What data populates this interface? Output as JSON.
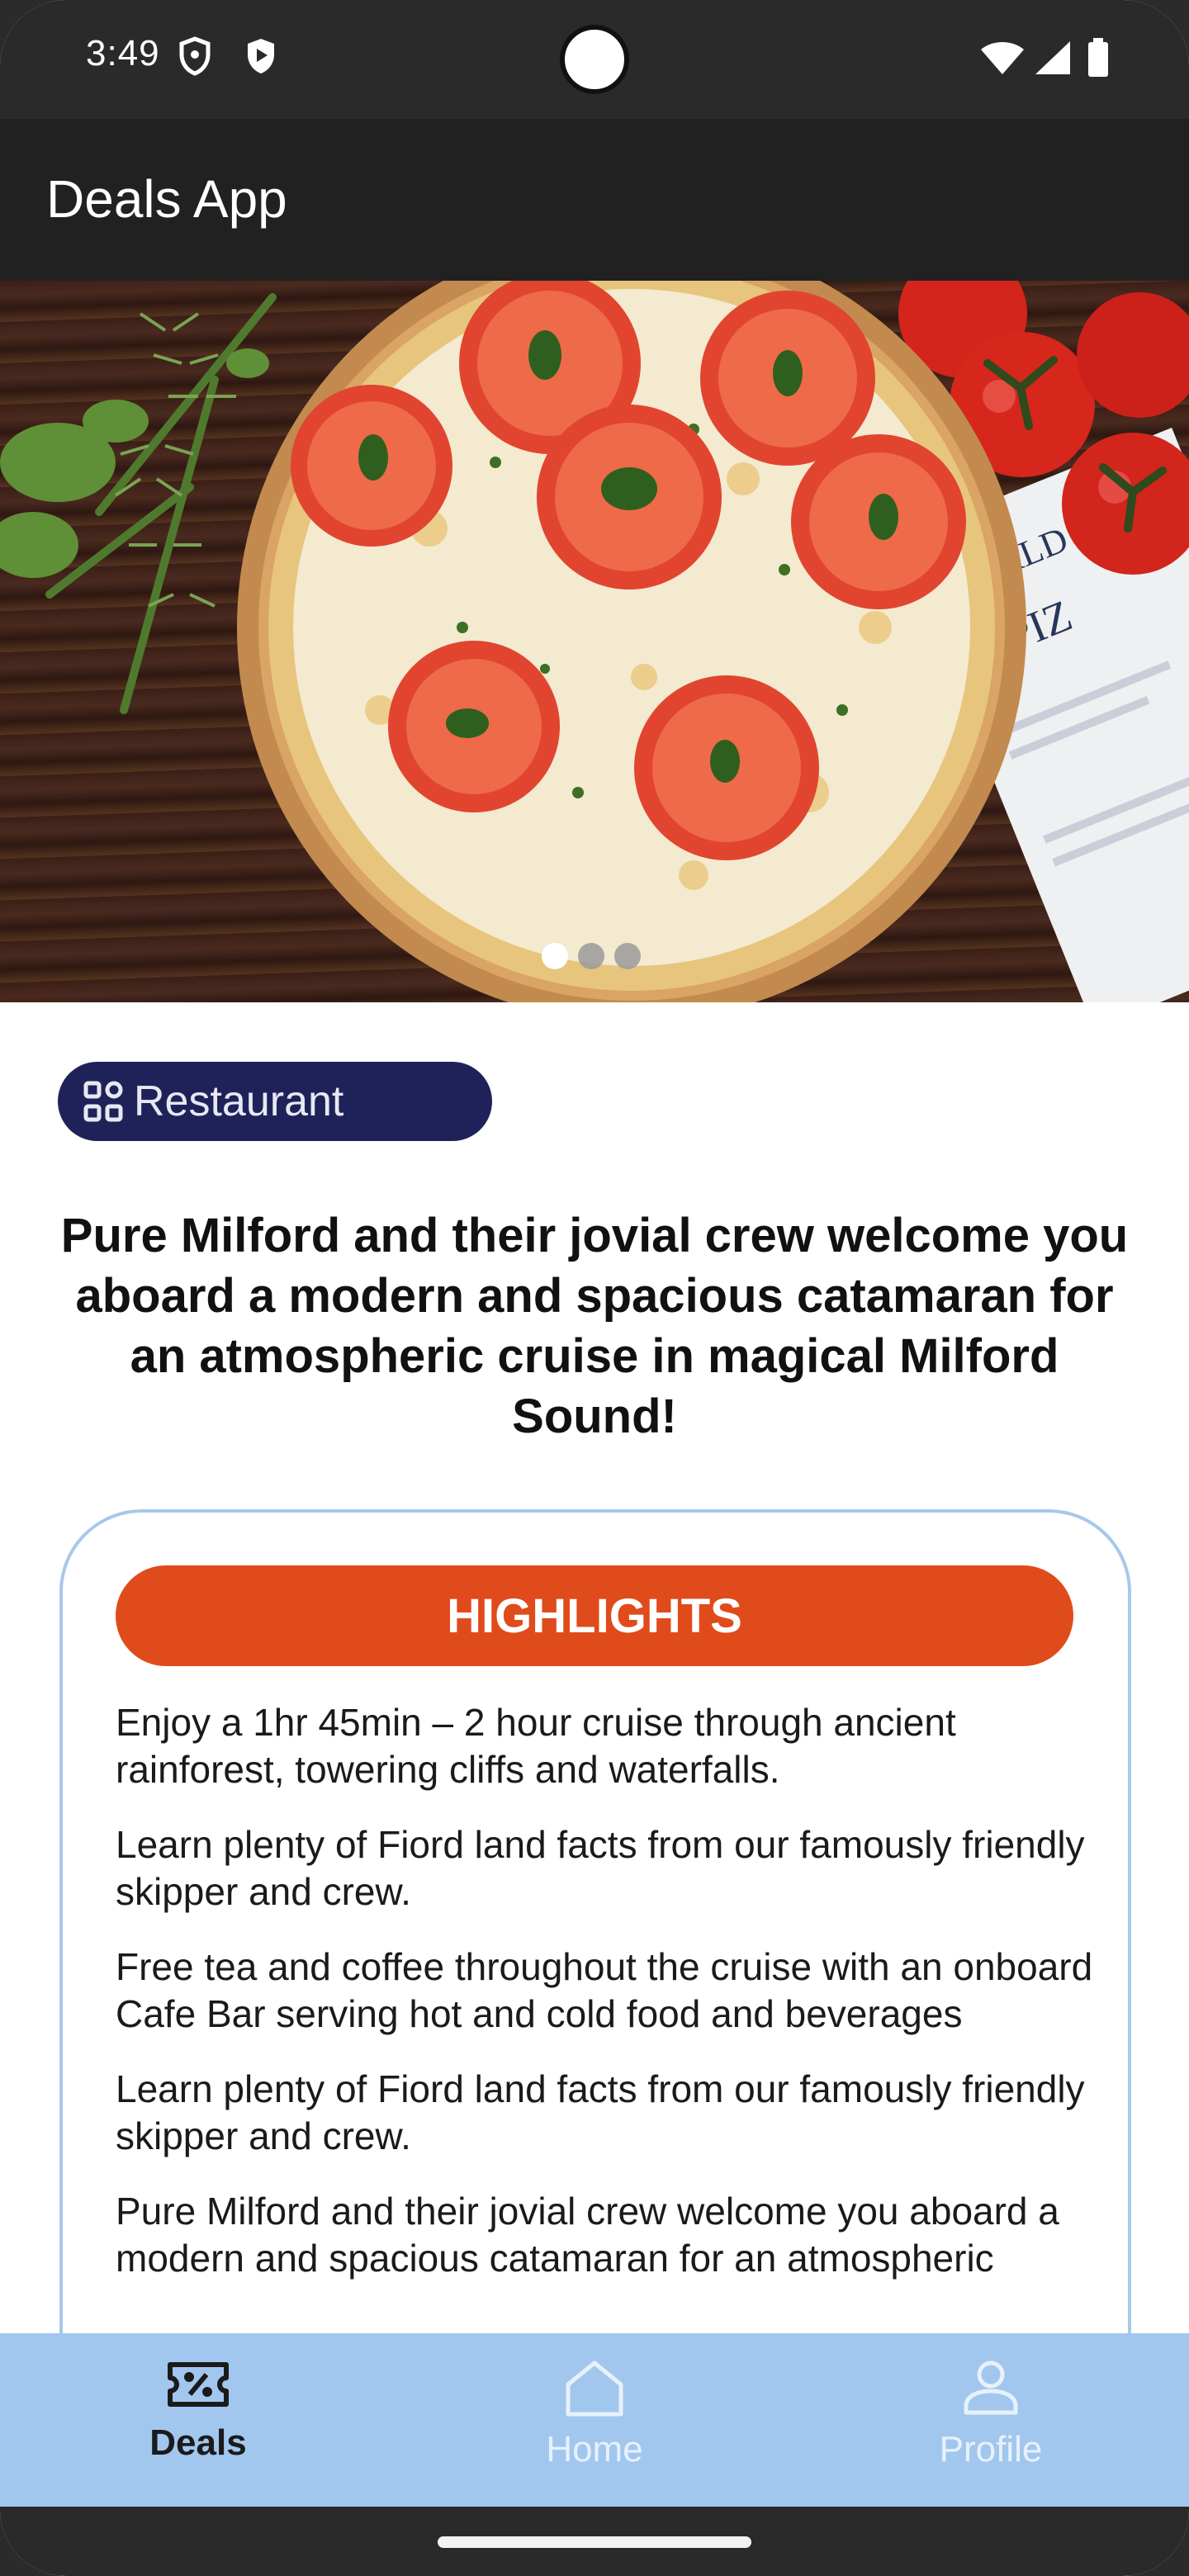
{
  "status_bar": {
    "time": "3:49",
    "icons": [
      "shield-outline-icon",
      "play-shield-icon",
      "wifi-icon",
      "signal-icon",
      "battery-icon"
    ]
  },
  "app_bar": {
    "title": "Deals App"
  },
  "carousel": {
    "image": "pizza-photo",
    "page_count": 3,
    "active_index": 0
  },
  "category_chip": {
    "icon": "grid-icon",
    "label": "Restaurant"
  },
  "headline": "Pure Milford and their jovial crew welcome you aboard a modern and spacious catamaran for an atmospheric cruise in magical Milford Sound!",
  "highlights": {
    "title": "HIGHLIGHTS",
    "items": [
      "Enjoy a 1hr 45min – 2 hour cruise through ancient rainforest, towering cliffs and waterfalls.",
      "Learn plenty of Fiord land facts from our famously friendly skipper and crew.",
      "Free tea and coffee throughout the cruise with an onboard Cafe Bar serving hot and cold food and beverages",
      "Learn plenty of Fiord land facts from our famously friendly skipper and crew.",
      "Pure Milford and their jovial crew welcome you aboard a modern and spacious catamaran for an atmospheric"
    ]
  },
  "bottom_nav": {
    "items": [
      {
        "label": "Deals",
        "icon": "discount-ticket-icon",
        "active": true
      },
      {
        "label": "Home",
        "icon": "home-icon",
        "active": false
      },
      {
        "label": "Profile",
        "icon": "person-icon",
        "active": false
      }
    ]
  },
  "colors": {
    "app_bar": "#212121",
    "chip": "#1f2259",
    "highlight_pill": "#e04b1c",
    "card_border": "#a8c8ea",
    "bottom_nav": "#a1c7ef"
  }
}
